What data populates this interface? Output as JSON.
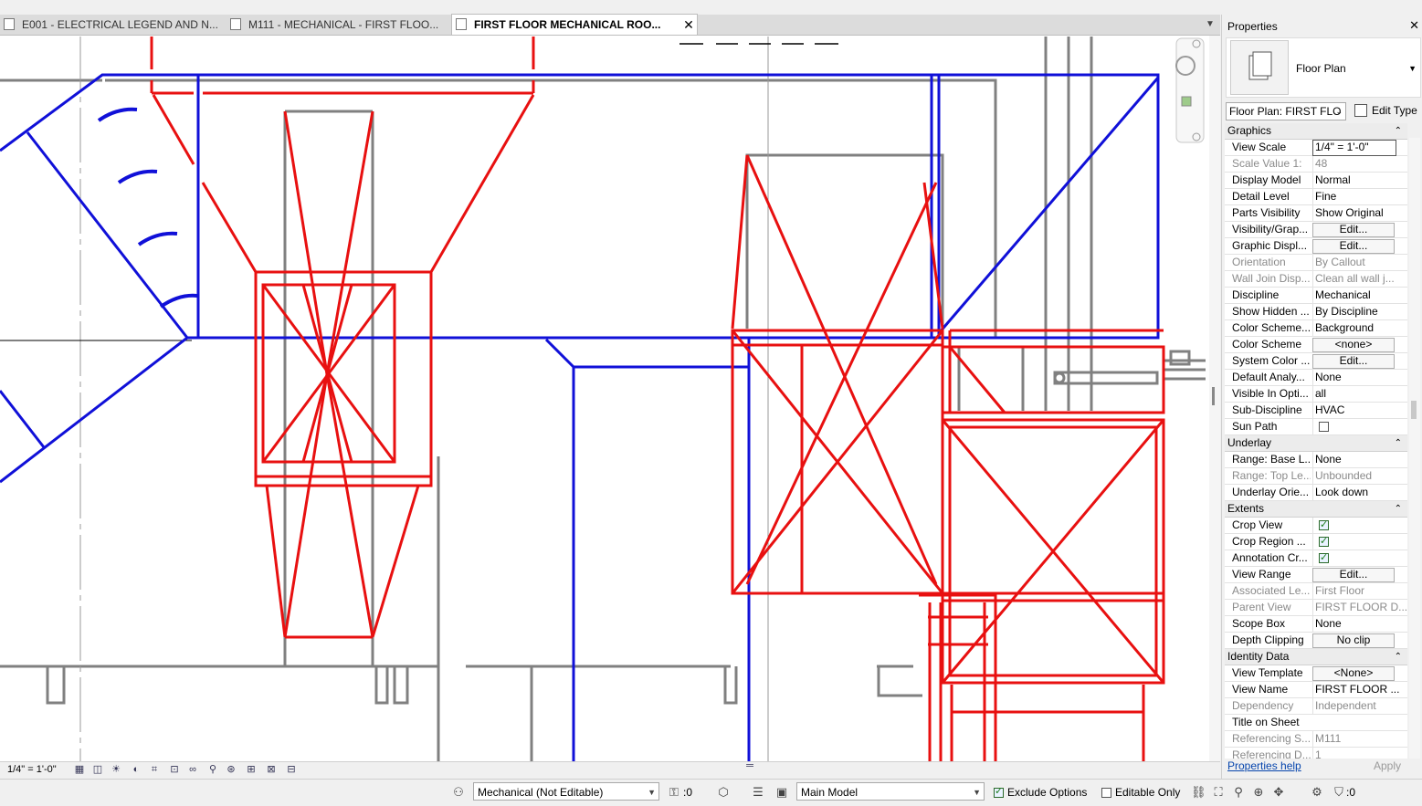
{
  "tabs": [
    {
      "label": "E001 - ELECTRICAL LEGEND AND N...",
      "active": false
    },
    {
      "label": "M111 - MECHANICAL - FIRST FLOO...",
      "active": false
    },
    {
      "label": "FIRST FLOOR MECHANICAL ROO...",
      "active": true
    }
  ],
  "tab_close": "✕",
  "tab_more": "▼",
  "view_bar": {
    "scale": "1/4\" = 1'-0\""
  },
  "status_bar": {
    "workset": "Mechanical (Not Editable)",
    "editable_count": ":0",
    "design_option": "Main Model",
    "exclude_options": "Exclude Options",
    "exclude_options_checked": true,
    "editable_only": "Editable Only",
    "editable_only_checked": false,
    "filter_count": ":0"
  },
  "properties": {
    "title": "Properties",
    "close": "✕",
    "type_name": "Floor Plan",
    "instance_selector": "Floor Plan: FIRST FLO",
    "edit_type": "Edit Type",
    "help": "Properties help",
    "apply": "Apply",
    "rows": [
      {
        "kind": "group",
        "name": "Graphics"
      },
      {
        "name": "View Scale",
        "value": "1/4\" = 1'-0\"",
        "style": "boxed"
      },
      {
        "name": "Scale Value    1:",
        "value": "48",
        "readonly": true
      },
      {
        "name": "Display Model",
        "value": "Normal"
      },
      {
        "name": "Detail Level",
        "value": "Fine"
      },
      {
        "name": "Parts Visibility",
        "value": "Show Original"
      },
      {
        "name": "Visibility/Grap...",
        "value": "Edit...",
        "style": "btn"
      },
      {
        "name": "Graphic Displ...",
        "value": "Edit...",
        "style": "btn"
      },
      {
        "name": "Orientation",
        "value": "By Callout",
        "readonly": true
      },
      {
        "name": "Wall Join Disp...",
        "value": "Clean all wall j...",
        "readonly": true
      },
      {
        "name": "Discipline",
        "value": "Mechanical"
      },
      {
        "name": "Show Hidden ...",
        "value": "By Discipline"
      },
      {
        "name": "Color Scheme...",
        "value": "Background"
      },
      {
        "name": "Color Scheme",
        "value": "<none>",
        "style": "btn"
      },
      {
        "name": "System Color ...",
        "value": "Edit...",
        "style": "btn"
      },
      {
        "name": "Default Analy...",
        "value": "None"
      },
      {
        "name": "Visible In Opti...",
        "value": "all"
      },
      {
        "name": "Sub-Discipline",
        "value": "HVAC"
      },
      {
        "name": "Sun Path",
        "value": "",
        "style": "check",
        "checked": false
      },
      {
        "kind": "group",
        "name": "Underlay"
      },
      {
        "name": "Range: Base L...",
        "value": "None"
      },
      {
        "name": "Range: Top Le...",
        "value": "Unbounded",
        "readonly": true
      },
      {
        "name": "Underlay Orie...",
        "value": "Look down"
      },
      {
        "kind": "group",
        "name": "Extents"
      },
      {
        "name": "Crop View",
        "value": "",
        "style": "check",
        "checked": true
      },
      {
        "name": "Crop Region ...",
        "value": "",
        "style": "check",
        "checked": true
      },
      {
        "name": "Annotation Cr...",
        "value": "",
        "style": "check",
        "checked": true
      },
      {
        "name": "View Range",
        "value": "Edit...",
        "style": "btn"
      },
      {
        "name": "Associated Le...",
        "value": "First Floor",
        "readonly": true
      },
      {
        "name": "Parent View",
        "value": "FIRST FLOOR D...",
        "readonly": true
      },
      {
        "name": "Scope Box",
        "value": "None"
      },
      {
        "name": "Depth Clipping",
        "value": "No clip",
        "style": "btn"
      },
      {
        "kind": "group",
        "name": "Identity Data"
      },
      {
        "name": "View Template",
        "value": "<None>",
        "style": "btn"
      },
      {
        "name": "View Name",
        "value": "FIRST FLOOR ..."
      },
      {
        "name": "Dependency",
        "value": "Independent",
        "readonly": true
      },
      {
        "name": "Title on Sheet",
        "value": ""
      },
      {
        "name": "Referencing S...",
        "value": "M111",
        "readonly": true
      },
      {
        "name": "Referencing D...",
        "value": "1",
        "readonly": true
      }
    ]
  },
  "colors": {
    "duct_red": "#e81010",
    "duct_blue": "#1010d8",
    "wall_gray": "#808080",
    "panel_bg": "#f0f0f0"
  }
}
